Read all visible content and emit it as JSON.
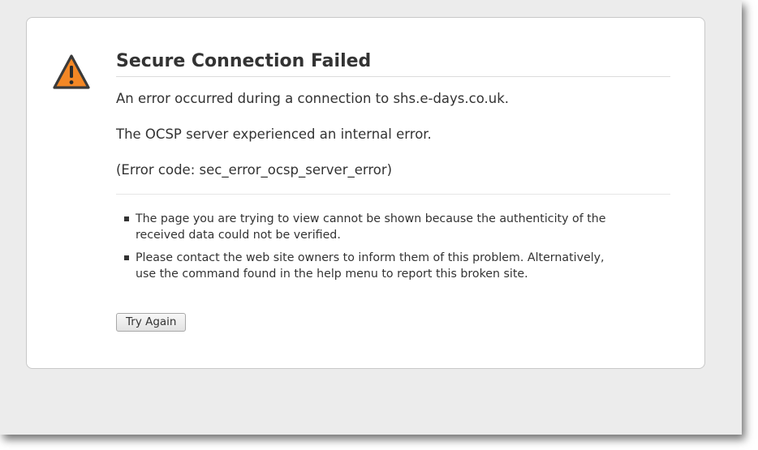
{
  "error_page": {
    "title": "Secure Connection Failed",
    "short_description": "An error occurred during a connection to shs.e-days.co.uk.",
    "detail": "The OCSP server experienced an internal error.",
    "error_code_line": "(Error code: sec_error_ocsp_server_error)",
    "long_description": [
      "The page you are trying to view cannot be shown because the authenticity of the received data could not be verified.",
      "Please contact the web site owners to inform them of this problem. Alternatively, use the command found in the help menu to report this broken site."
    ],
    "try_again_label": "Try Again",
    "icon": "warning-triangle-icon"
  },
  "colors": {
    "window_background": "#ececec",
    "panel_background": "#ffffff",
    "warning_icon_fill": "#f38725",
    "text": "#333333"
  }
}
